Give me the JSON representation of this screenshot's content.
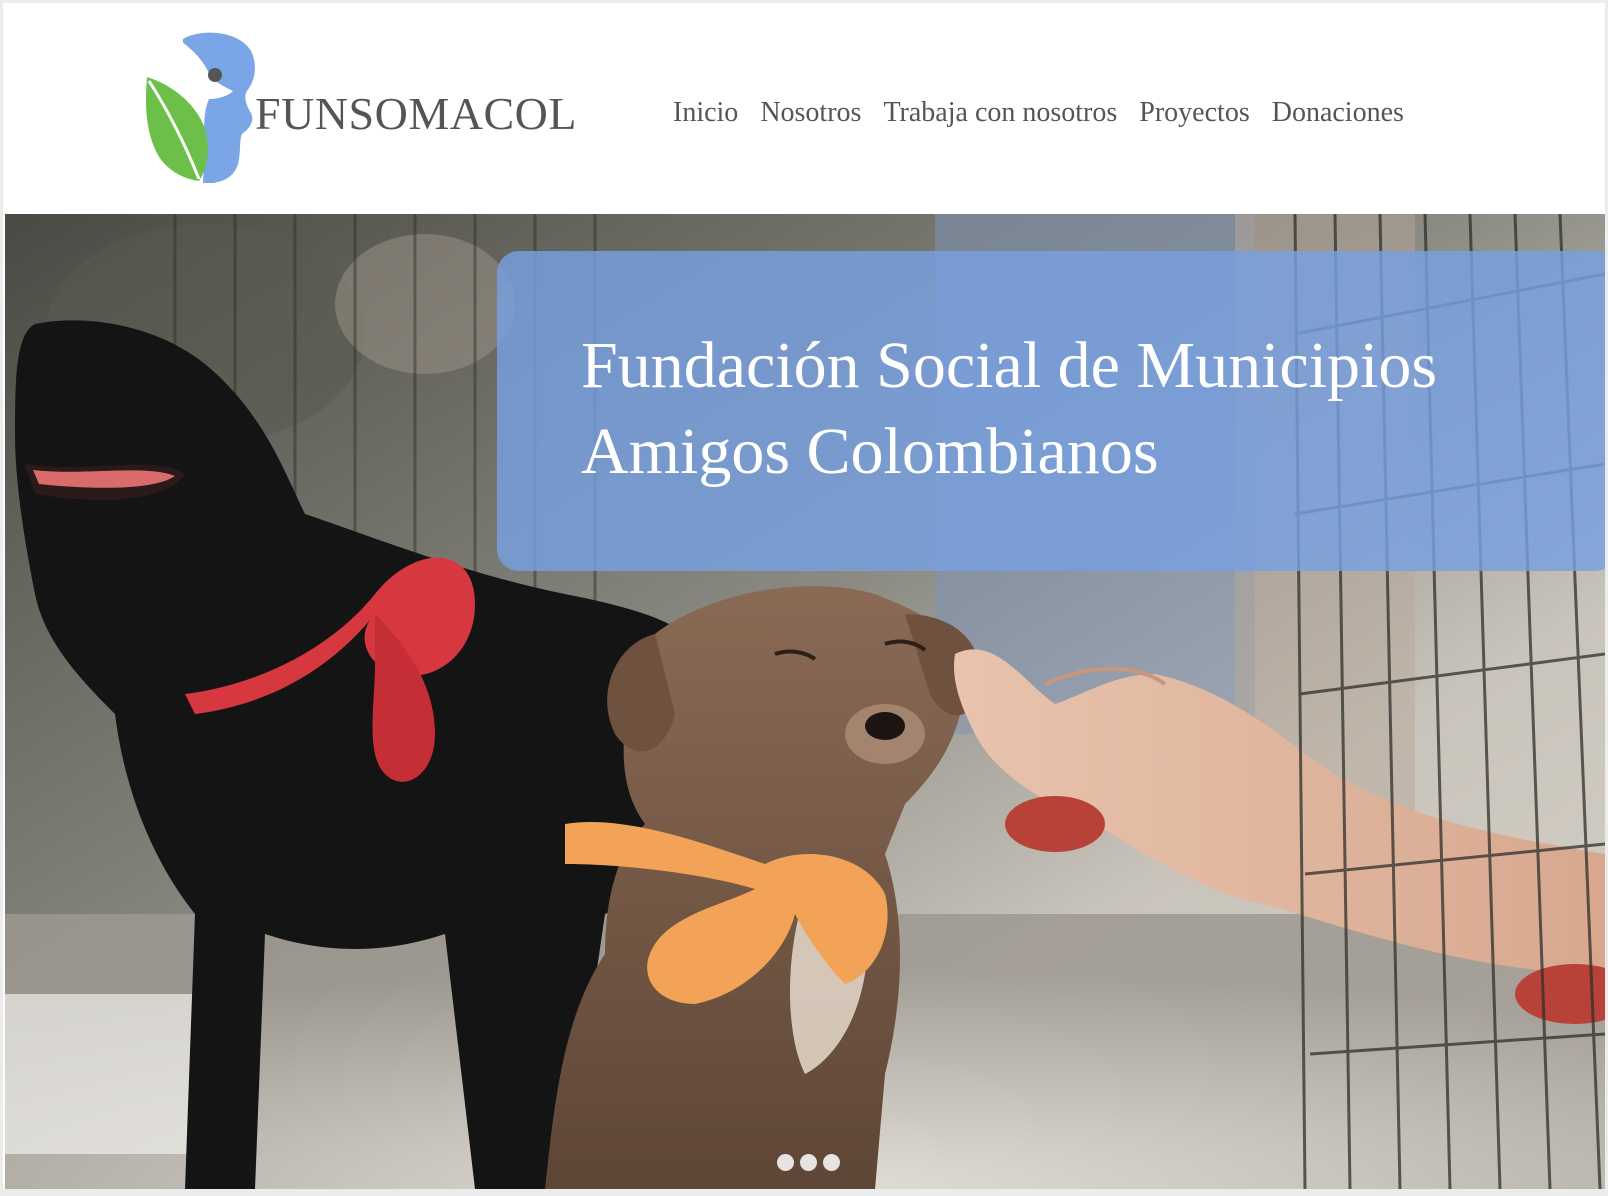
{
  "brand": {
    "name": "FUNSOMACOL",
    "logo_icon": "dog-leaf-logo-icon",
    "colors": {
      "logo_blue": "#6f9fe0",
      "logo_green": "#6cc04a",
      "text_gray": "#555555"
    }
  },
  "nav": {
    "items": [
      {
        "label": "Inicio"
      },
      {
        "label": "Nosotros"
      },
      {
        "label": "Trabaja con nosotros"
      },
      {
        "label": "Proyectos"
      },
      {
        "label": "Donaciones"
      }
    ]
  },
  "hero": {
    "title_line1": "Fundación Social de Municipios",
    "title_line2": "Amigos Colombianos",
    "caption_bg": "#78a0e1",
    "photo_subject": "dogs-in-shelter-photo",
    "slides": [
      {
        "state": "inactive"
      },
      {
        "state": "inactive"
      },
      {
        "state": "inactive"
      }
    ]
  }
}
